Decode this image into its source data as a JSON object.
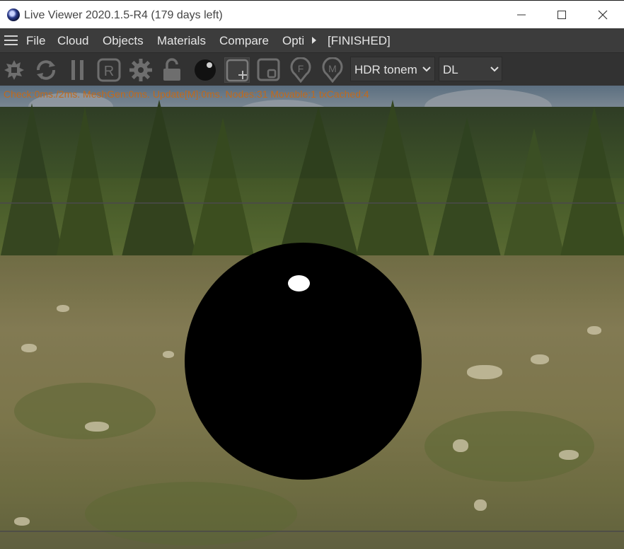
{
  "window": {
    "title": "Live Viewer 2020.1.5-R4 (179 days left)"
  },
  "menu": {
    "items": [
      "File",
      "Cloud",
      "Objects",
      "Materials",
      "Compare",
      "Opti"
    ],
    "status": "[FINISHED]"
  },
  "toolbar": {
    "buttons": [
      {
        "icon": "aperture-icon"
      },
      {
        "icon": "refresh-icon"
      },
      {
        "icon": "pause-icon"
      },
      {
        "icon": "region-r-icon",
        "letter": "R"
      },
      {
        "icon": "settings-gear-icon"
      },
      {
        "icon": "lock-open-icon"
      },
      {
        "icon": "material-sphere-icon"
      },
      {
        "icon": "add-region-icon"
      },
      {
        "icon": "region-small-icon"
      },
      {
        "icon": "focus-f-icon",
        "letter": "F"
      },
      {
        "icon": "material-pick-m-icon",
        "letter": "M"
      }
    ],
    "tonemap": {
      "value": "HDR tonem"
    },
    "kernel": {
      "value": "DL"
    }
  },
  "viewport": {
    "stats": "Check:0ms./2ms. MeshGen:0ms. Update[M]:0ms. Nodes:31 Movable:1 txCached:4"
  },
  "colors": {
    "titlebar_bg": "#ffffff",
    "menubar_bg": "#3c3c3c",
    "toolbar_bg": "#323232",
    "stats_text": "#c06a1c",
    "icon_gray": "#6e6e6e"
  }
}
